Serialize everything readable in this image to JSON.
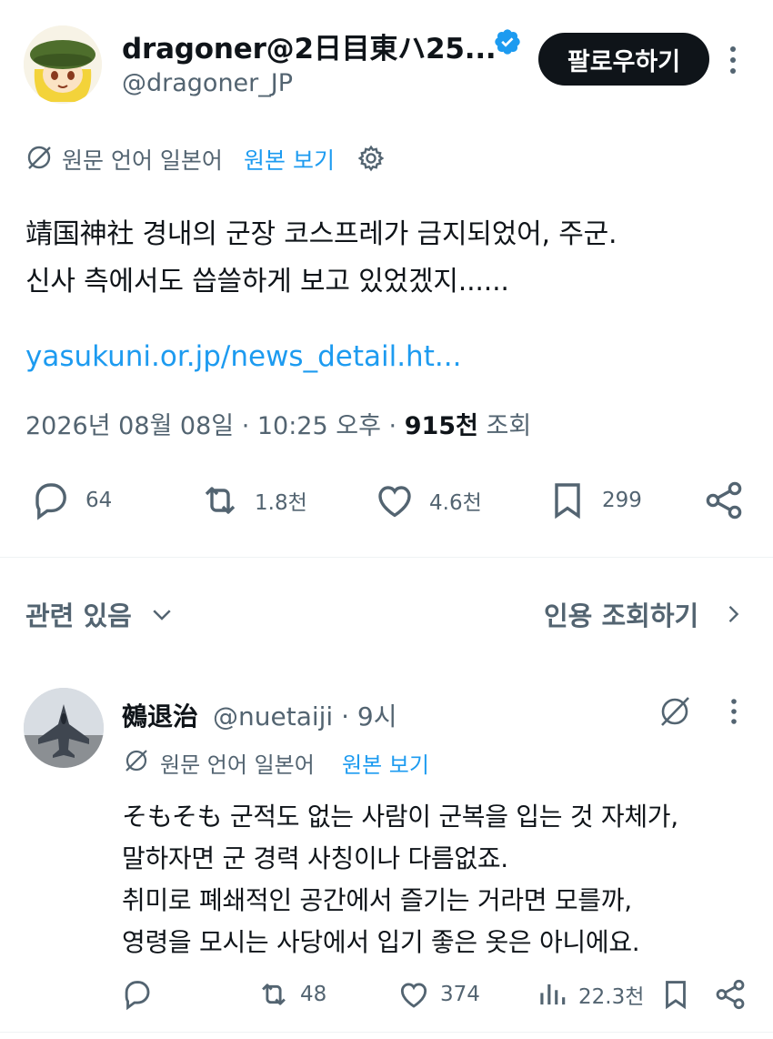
{
  "author": {
    "name": "dragoner@2日目東ハ25...",
    "handle": "@dragoner_JP",
    "follow_label": "팔로우하기"
  },
  "translation": {
    "language_text": "원문 언어 일본어",
    "show_original": "원본 보기"
  },
  "tweet": {
    "line1": "靖国神社 경내의 군장 코스프레가 금지되었어, 주군.",
    "line2": "신사 측에서도 씁쓸하게 보고 있었겠지......",
    "link": "yasukuni.or.jp/news_detail.ht...",
    "meta_prefix": "2026년 08월 08일 · 10:25 오후 · ",
    "views_count": "915천",
    "views_label": "조회"
  },
  "actions": {
    "replies": "64",
    "reposts": "1.8천",
    "likes": "4.6천",
    "bookmarks": "299"
  },
  "related": {
    "label": "관련 있음",
    "quotes_label": "인용 조회하기"
  },
  "reply": {
    "name": "鵺退治",
    "handle_time": "@nuetaiji · 9시",
    "language_text": "원문 언어 일본어",
    "show_original": "원본 보기",
    "lines": [
      "そもそも 군적도 없는 사람이 군복을 입는 것 자체가,",
      "말하자면 군 경력 사칭이나 다름없죠.",
      "취미로 폐쇄적인 공간에서 즐기는 거라면 모를까,",
      "영령을 모시는 사당에서 입기 좋은 옷은 아니에요."
    ],
    "actions": {
      "reposts": "48",
      "likes": "374",
      "views": "22.3천"
    }
  },
  "colors": {
    "text": "#0f1419",
    "secondary": "#536471",
    "accent": "#1d9bf0",
    "divider": "#eff3f4"
  },
  "icons": [
    "verified-badge-icon",
    "more-icon",
    "translate-icon",
    "gear-icon",
    "reply-icon",
    "repost-icon",
    "like-icon",
    "bookmark-icon",
    "share-icon",
    "chevron-down-icon",
    "chevron-right-icon",
    "views-icon"
  ]
}
